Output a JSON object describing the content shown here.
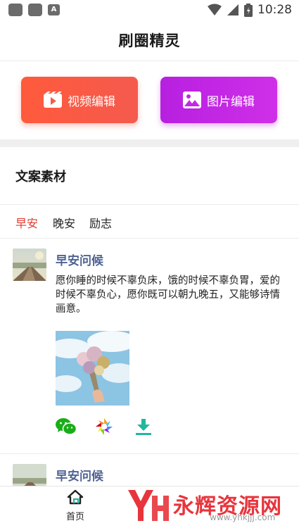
{
  "status_bar": {
    "time": "10:28",
    "notification_badge": "A"
  },
  "header": {
    "title": "刷圈精灵"
  },
  "actions": {
    "video_edit_label": "视频编辑",
    "image_edit_label": "图片编辑"
  },
  "section": {
    "title": "文案素材"
  },
  "tabs": [
    {
      "label": "早安",
      "active": true
    },
    {
      "label": "晚安",
      "active": false
    },
    {
      "label": "励志",
      "active": false
    }
  ],
  "posts": [
    {
      "title": "早安问候",
      "text": "愿你睡的时候不辜负床，饿的时候不辜负胃，爱的时候不辜负心，愿你既可以朝九晚五，又能够诗情画意。"
    },
    {
      "title": "早安问候"
    }
  ],
  "bottom_nav": {
    "home_label": "首页"
  },
  "watermark": {
    "text": "永辉资源网",
    "url": "www.yhkjjj.com"
  },
  "colors": {
    "accent_red": "#e03a2f",
    "video_button": "#ff5a3c",
    "image_button": "#c12ae4",
    "post_title": "#4f6393"
  }
}
